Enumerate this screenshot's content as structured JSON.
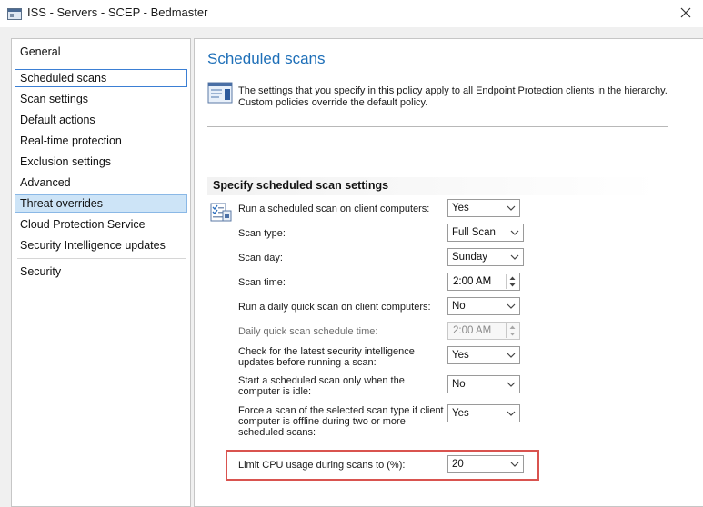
{
  "window": {
    "title": "ISS - Servers - SCEP - Bedmaster",
    "close_icon": "close-icon"
  },
  "nav": {
    "items": [
      {
        "label": "General"
      },
      {
        "label": "Scheduled scans"
      },
      {
        "label": "Scan settings"
      },
      {
        "label": "Default actions"
      },
      {
        "label": "Real-time protection"
      },
      {
        "label": "Exclusion settings"
      },
      {
        "label": "Advanced"
      },
      {
        "label": "Threat overrides"
      },
      {
        "label": "Cloud Protection Service"
      },
      {
        "label": "Security Intelligence updates"
      },
      {
        "label": "Security"
      }
    ],
    "focused_item": "Scheduled scans",
    "selected_item": "Threat overrides"
  },
  "content": {
    "title": "Scheduled scans",
    "info_text_line1": "The settings that you specify in this policy apply to all Endpoint Protection clients in the hierarchy.",
    "info_text_line2": "Custom policies override the default policy.",
    "section_header": "Specify scheduled scan settings",
    "rows": [
      {
        "label": "Run a scheduled scan on client computers:",
        "value": "Yes",
        "control": "dropdown"
      },
      {
        "label": "Scan type:",
        "value": "Full Scan",
        "control": "dropdown"
      },
      {
        "label": "Scan day:",
        "value": "Sunday",
        "control": "dropdown"
      },
      {
        "label": "Scan time:",
        "value": "2:00 AM",
        "control": "spin"
      },
      {
        "label": "Run a daily quick scan on client computers:",
        "value": "No",
        "control": "dropdown"
      },
      {
        "label": "Daily quick scan schedule time:",
        "value": "2:00 AM",
        "control": "spin",
        "disabled": true
      },
      {
        "label_line1": "Check for the latest security intelligence",
        "label_line2": "updates before running a scan:",
        "value": "Yes",
        "control": "dropdown"
      },
      {
        "label_line1": "Start a scheduled scan only when the",
        "label_line2": "computer is idle:",
        "value": "No",
        "control": "dropdown"
      },
      {
        "label_line1": "Force a scan of the selected scan type if client",
        "label_line2": "computer is offline during two or more",
        "label_line3": "scheduled scans:",
        "value": "Yes",
        "control": "dropdown"
      },
      {
        "label": "Limit CPU usage during scans to (%):",
        "value": "20",
        "control": "dropdown",
        "highlighted": true
      }
    ]
  },
  "colors": {
    "accent_title": "#1e6fb8",
    "selection_bg": "#cde4f7",
    "highlight_border": "#d9534f"
  }
}
